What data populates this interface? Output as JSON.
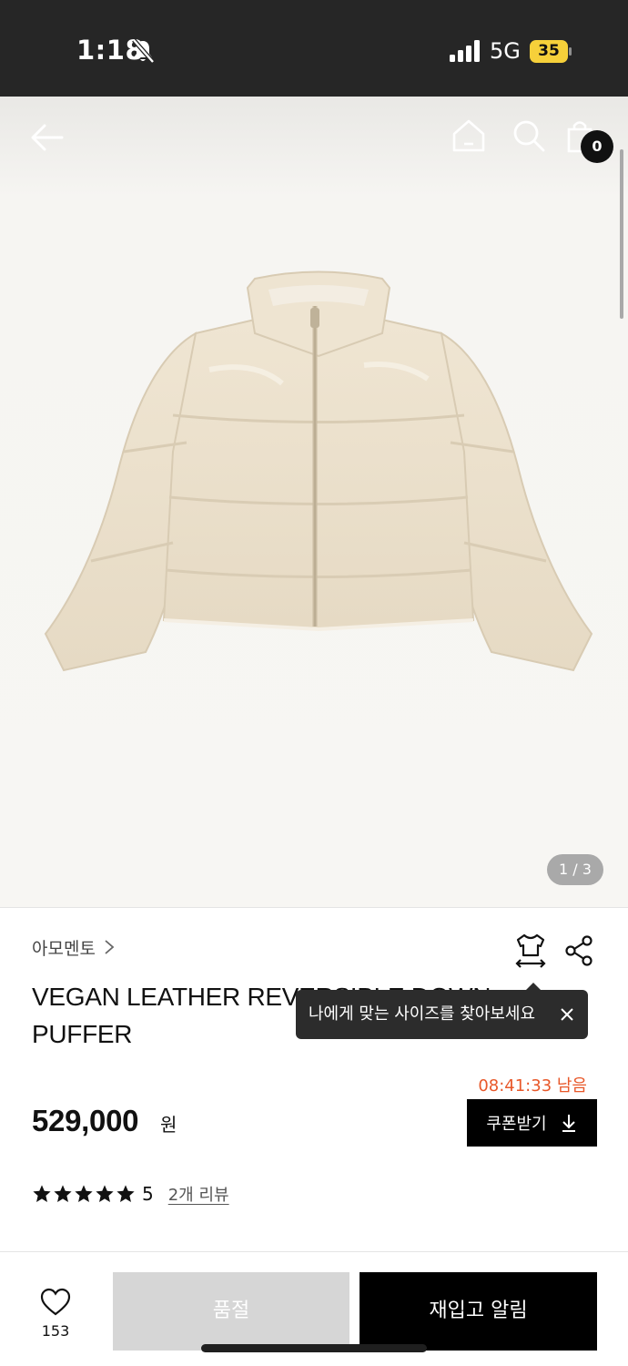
{
  "status_bar": {
    "time": "1:18",
    "network": "5G",
    "battery": "35"
  },
  "gallery": {
    "page_indicator": "1 / 3",
    "cart_count": "0"
  },
  "product": {
    "brand": "아모멘토",
    "title": "VEGAN LEATHER REVERSIBLE DOWN PUFFER",
    "price": "529,000",
    "price_unit": "원",
    "coupon_timer": "08:41:33 남음",
    "coupon_button": "쿠폰받기",
    "rating": "5",
    "star_count": 5,
    "reviews_link": "2개 리뷰"
  },
  "tooltip": {
    "text": "나에게 맞는 사이즈를 찾아보세요"
  },
  "bottom_bar": {
    "like_count": "153",
    "soldout_label": "품절",
    "restock_label": "재입고 알림"
  },
  "colors": {
    "accent_timer": "#e8582a",
    "battery": "#f6d03a",
    "primary_button": "#000000",
    "disabled_button": "#d6d6d6"
  }
}
